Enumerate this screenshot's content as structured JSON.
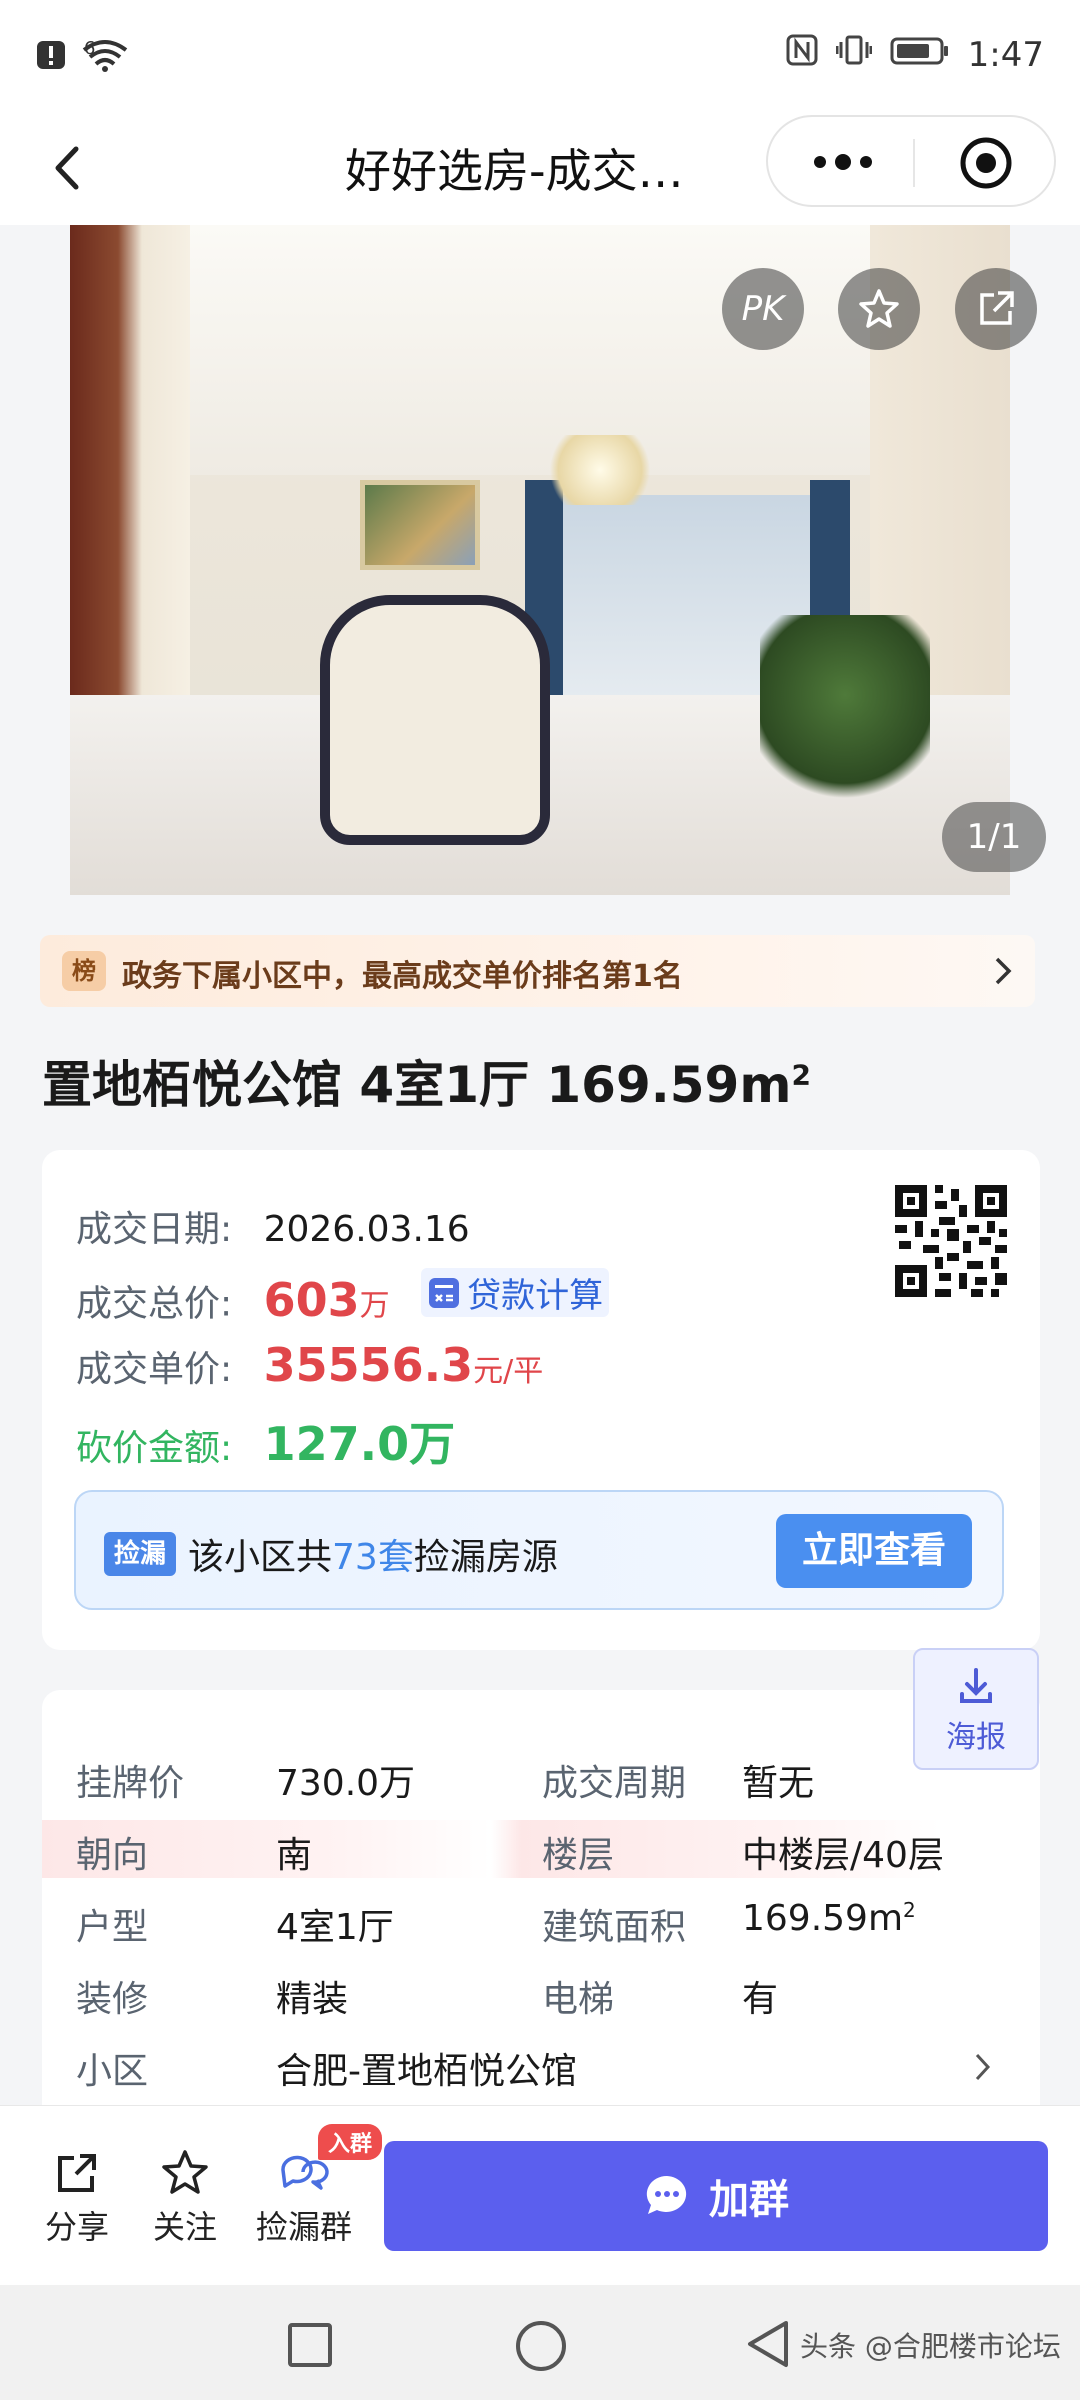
{
  "status_bar": {
    "time": "1:47",
    "signal_label": "6"
  },
  "nav": {
    "title": "好好选房-成交…"
  },
  "hero": {
    "pk_label": "PK",
    "pager": "1/1"
  },
  "rank": {
    "badge": "榜",
    "text": "政务下属小区中，最高成交单价排名第1名"
  },
  "listing": {
    "title": "置地栢悦公馆 4室1厅 169.59m",
    "title_sup": "2"
  },
  "deal": {
    "date_label": "成交日期:",
    "date_value": "2026.03.16",
    "total_label": "成交总价:",
    "total_value": "603",
    "total_unit": "万",
    "loan_label": "贷款计算",
    "unit_label": "成交单价:",
    "unit_value": "35556.3",
    "unit_unit": "元/平",
    "discount_label": "砍价金额:",
    "discount_value": "127.0万"
  },
  "leak": {
    "tag": "捡漏",
    "text_pre": "该小区共",
    "count": "73套",
    "text_post": "捡漏房源",
    "button": "立即查看"
  },
  "poster": {
    "label": "海报"
  },
  "details": {
    "rows": [
      {
        "k1": "挂牌价",
        "v1": "730.0万",
        "k2": "成交周期",
        "v2": "暂无"
      },
      {
        "k1": "朝向",
        "v1": "南",
        "k2": "楼层",
        "v2": "中楼层/40层"
      },
      {
        "k1": "户型",
        "v1": "4室1厅",
        "k2": "建筑面积",
        "v2": "169.59m"
      },
      {
        "k1": "装修",
        "v1": "精装",
        "k2": "电梯",
        "v2": "有"
      },
      {
        "k1": "小区",
        "v1": "合肥-置地栢悦公馆"
      }
    ],
    "area_sup": "2"
  },
  "bottom": {
    "share": "分享",
    "follow": "关注",
    "group": "捡漏群",
    "group_badge": "入群",
    "join": "加群"
  },
  "watermark": "头条 @合肥楼市论坛",
  "colors": {
    "price_red": "#e0464a",
    "discount_green": "#32b560",
    "accent_blue": "#4a8ff0",
    "join_purple": "#5b5fee"
  }
}
